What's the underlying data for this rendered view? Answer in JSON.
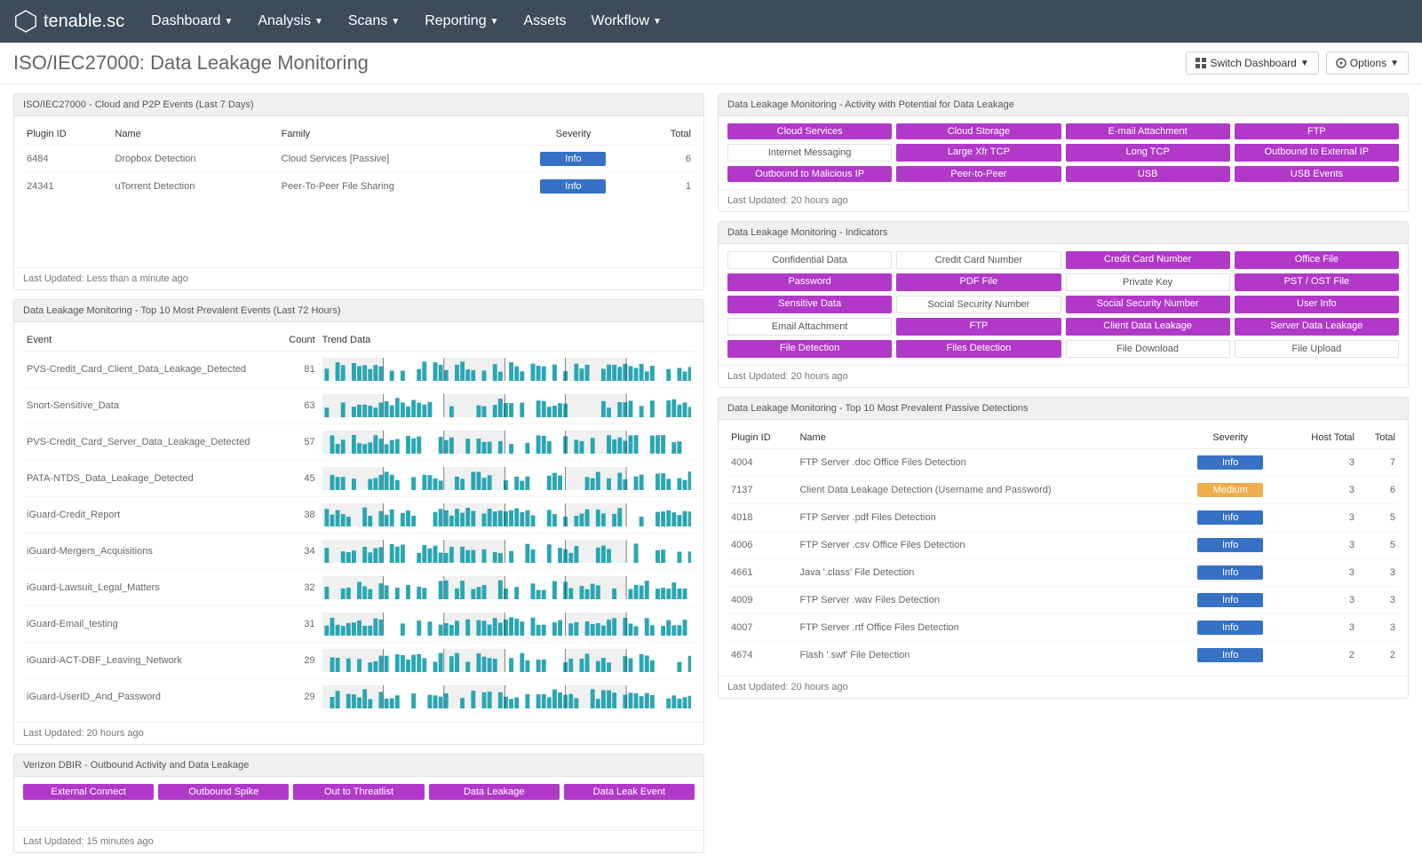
{
  "nav": {
    "brand": "tenable.sc",
    "items": [
      "Dashboard",
      "Analysis",
      "Scans",
      "Reporting",
      "Assets",
      "Workflow"
    ],
    "has_caret": [
      true,
      true,
      true,
      true,
      false,
      true
    ]
  },
  "page": {
    "title": "ISO/IEC27000: Data Leakage Monitoring",
    "switch_btn": "Switch Dashboard",
    "options_btn": "Options"
  },
  "panel_cloud": {
    "title": "ISO/IEC27000 - Cloud and P2P Events (Last 7 Days)",
    "headers": [
      "Plugin ID",
      "Name",
      "Family",
      "Severity",
      "Total"
    ],
    "rows": [
      {
        "id": "6484",
        "name": "Dropbox Detection",
        "family": "Cloud Services [Passive]",
        "severity": "Info",
        "total": "6"
      },
      {
        "id": "24341",
        "name": "uTorrent Detection",
        "family": "Peer-To-Peer File Sharing",
        "severity": "Info",
        "total": "1"
      }
    ],
    "footer": "Last Updated: Less than a minute ago"
  },
  "panel_top10": {
    "title": "Data Leakage Monitoring - Top 10 Most Prevalent Events (Last 72 Hours)",
    "headers": [
      "Event",
      "Count",
      "Trend Data"
    ],
    "rows": [
      {
        "event": "PVS-Credit_Card_Client_Data_Leakage_Detected",
        "count": "81"
      },
      {
        "event": "Snort-Sensitive_Data",
        "count": "63"
      },
      {
        "event": "PVS-Credit_Card_Server_Data_Leakage_Detected",
        "count": "57"
      },
      {
        "event": "PATA-NTDS_Data_Leakage_Detected",
        "count": "45"
      },
      {
        "event": "iGuard-Credit_Report",
        "count": "38"
      },
      {
        "event": "iGuard-Mergers_Acquisitions",
        "count": "34"
      },
      {
        "event": "iGuard-Lawsuit_Legal_Matters",
        "count": "32"
      },
      {
        "event": "iGuard-Email_testing",
        "count": "31"
      },
      {
        "event": "iGuard-ACT-DBF_Leaving_Network",
        "count": "29"
      },
      {
        "event": "iGuard-UserID_And_Password",
        "count": "29"
      }
    ],
    "footer": "Last Updated: 20 hours ago"
  },
  "panel_verizon": {
    "title": "Verizon DBIR - Outbound Activity and Data Leakage",
    "pills": [
      "External Connect",
      "Outbound Spike",
      "Out to Threatlist",
      "Data Leakage",
      "Data Leak Event"
    ],
    "footer": "Last Updated: 15 minutes ago"
  },
  "panel_activity": {
    "title": "Data Leakage Monitoring - Activity with Potential for Data Leakage",
    "cells": [
      {
        "t": "Cloud Services",
        "p": false
      },
      {
        "t": "Cloud Storage",
        "p": false
      },
      {
        "t": "E-mail Attachment",
        "p": false
      },
      {
        "t": "FTP",
        "p": false
      },
      {
        "t": "Internet Messaging",
        "p": true
      },
      {
        "t": "Large Xfr TCP",
        "p": false
      },
      {
        "t": "Long TCP",
        "p": false
      },
      {
        "t": "Outbound to External IP",
        "p": false
      },
      {
        "t": "Outbound to Malicious IP",
        "p": false
      },
      {
        "t": "Peer-to-Peer",
        "p": false
      },
      {
        "t": "USB",
        "p": false
      },
      {
        "t": "USB Events",
        "p": false
      }
    ],
    "footer": "Last Updated: 20 hours ago"
  },
  "panel_indicators": {
    "title": "Data Leakage Monitoring - Indicators",
    "cells": [
      {
        "t": "Confidential Data",
        "p": true
      },
      {
        "t": "Credit Card Number",
        "p": true
      },
      {
        "t": "Credit Card Number",
        "p": false
      },
      {
        "t": "Office File",
        "p": false
      },
      {
        "t": "Password",
        "p": false
      },
      {
        "t": "PDF File",
        "p": false
      },
      {
        "t": "Private Key",
        "p": true
      },
      {
        "t": "PST / OST File",
        "p": false
      },
      {
        "t": "Sensitive Data",
        "p": false
      },
      {
        "t": "Social Security Number",
        "p": true
      },
      {
        "t": "Social Security Number",
        "p": false
      },
      {
        "t": "User Info",
        "p": false
      },
      {
        "t": "Email Attachment",
        "p": true
      },
      {
        "t": "FTP",
        "p": false
      },
      {
        "t": "Client Data Leakage",
        "p": false
      },
      {
        "t": "Server Data Leakage",
        "p": false
      },
      {
        "t": "File Detection",
        "p": false
      },
      {
        "t": "Files Detection",
        "p": false
      },
      {
        "t": "File Download",
        "p": true
      },
      {
        "t": "File Upload",
        "p": true
      }
    ],
    "footer": "Last Updated: 20 hours ago"
  },
  "panel_passive": {
    "title": "Data Leakage Monitoring - Top 10 Most Prevalent Passive Detections",
    "headers": [
      "Plugin ID",
      "Name",
      "Severity",
      "Host Total",
      "Total"
    ],
    "rows": [
      {
        "id": "4004",
        "name": "FTP Server .doc Office Files Detection",
        "sev": "Info",
        "sevcls": "pill-info",
        "host": "3",
        "total": "7"
      },
      {
        "id": "7137",
        "name": "Client Data Leakage Detection (Username and Password)",
        "sev": "Medium",
        "sevcls": "pill-medium",
        "host": "3",
        "total": "6"
      },
      {
        "id": "4018",
        "name": "FTP Server .pdf Files Detection",
        "sev": "Info",
        "sevcls": "pill-info",
        "host": "3",
        "total": "5"
      },
      {
        "id": "4006",
        "name": "FTP Server .csv Office Files Detection",
        "sev": "Info",
        "sevcls": "pill-info",
        "host": "3",
        "total": "5"
      },
      {
        "id": "4661",
        "name": "Java '.class' File Detection",
        "sev": "Info",
        "sevcls": "pill-info",
        "host": "3",
        "total": "3"
      },
      {
        "id": "4009",
        "name": "FTP Server .wav Files Detection",
        "sev": "Info",
        "sevcls": "pill-info",
        "host": "3",
        "total": "3"
      },
      {
        "id": "4007",
        "name": "FTP Server .rtf Office Files Detection",
        "sev": "Info",
        "sevcls": "pill-info",
        "host": "3",
        "total": "3"
      },
      {
        "id": "4674",
        "name": "Flash '.swf' File Detection",
        "sev": "Info",
        "sevcls": "pill-info",
        "host": "2",
        "total": "2"
      }
    ],
    "footer": "Last Updated: 20 hours ago"
  }
}
